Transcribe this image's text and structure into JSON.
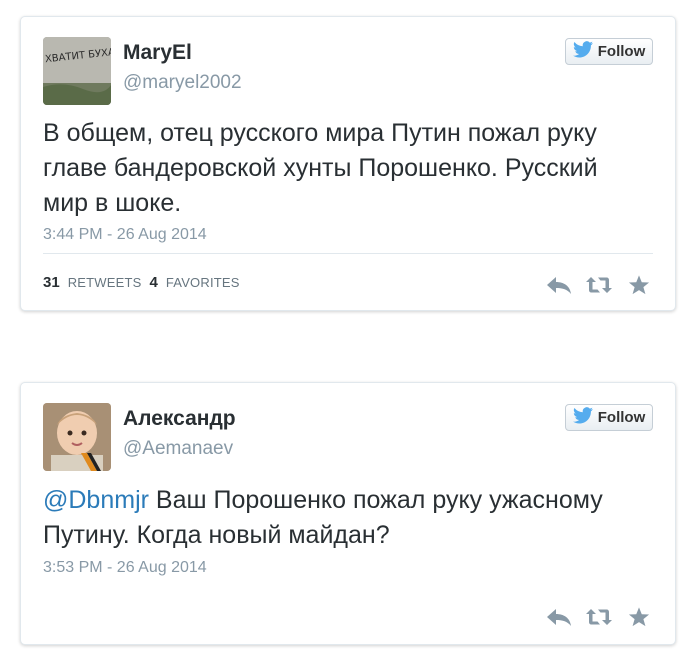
{
  "tweets": [
    {
      "display_name": "MaryEl",
      "handle": "@maryel2002",
      "avatar_text": "ХВАТИТ БУХАТЬ",
      "follow_label": "Follow",
      "text": "В общем, отец русского мира Путин пожал руку главе бандеровской хунты Порошенко. Русский мир в шоке.",
      "timestamp": "3:44 PM - 26 Aug 2014",
      "retweets_count": "31",
      "retweets_label": "RETWEETS",
      "favorites_count": "4",
      "favorites_label": "FAVORITES"
    },
    {
      "display_name": "Александр",
      "handle": "@Aemanaev",
      "follow_label": "Follow",
      "mention": "@Dbnmjr",
      "text": " Ваш Порошенко пожал руку ужасному Путину. Когда новый майдан?",
      "timestamp": "3:53 PM - 26 Aug 2014"
    }
  ],
  "icons": {
    "bird": "twitter-bird-icon",
    "reply": "reply-icon",
    "retweet": "retweet-icon",
    "favorite": "star-icon"
  },
  "colors": {
    "bird_blue": "#55acee",
    "mention_blue": "#2b7bb9",
    "icon_gray": "#8899a6",
    "text_dark": "#292f33"
  }
}
